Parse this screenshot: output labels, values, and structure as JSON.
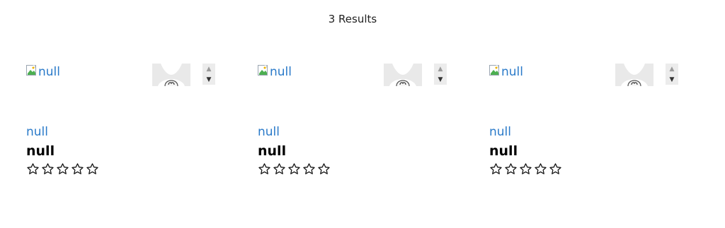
{
  "results": {
    "count_label": "3 Results"
  },
  "icons": {
    "broken_image": "broken-image-icon",
    "stepper_up": "arrow-up-icon",
    "stepper_down": "arrow-down-icon",
    "star": "star-outline-icon"
  },
  "colors": {
    "link": "#2a7ac9",
    "text": "#000000"
  },
  "products": [
    {
      "image_alt": "null",
      "brand": "null",
      "name": "null",
      "rating": 0,
      "rating_max": 5
    },
    {
      "image_alt": "null",
      "brand": "null",
      "name": "null",
      "rating": 0,
      "rating_max": 5
    },
    {
      "image_alt": "null",
      "brand": "null",
      "name": "null",
      "rating": 0,
      "rating_max": 5
    }
  ]
}
